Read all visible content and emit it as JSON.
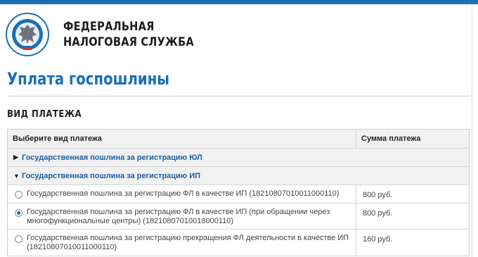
{
  "header": {
    "org_line1": "ФЕДЕРАЛЬНАЯ",
    "org_line2": "НАЛОГОВАЯ СЛУЖБА"
  },
  "page_title": "Уплата госпошлины",
  "section_title": "ВИД ПЛАТЕЖА",
  "table": {
    "col_type": "Выберите вид платежа",
    "col_sum": "Сумма платежа",
    "groups": [
      {
        "label": "Государственная пошлина за регистрацию ЮЛ",
        "expanded": false
      },
      {
        "label": "Государственная пошлина за регистрацию ИП",
        "expanded": true
      }
    ],
    "options": [
      {
        "label": "Государственная пошлина за регистрацию ФЛ в качестве ИП (18210807010011000110)",
        "sum": "800 руб.",
        "selected": false
      },
      {
        "label_line1": "Государственная пошлина за регистрацию ФЛ в качестве ИП (при обращении через",
        "label_line2": "многофункциональные центры) (18210807010018000110)",
        "sum": "800 руб.",
        "selected": true
      },
      {
        "label_line1": "Государственная пошлина за регистрацию прекращения ФЛ деятельности в качестве ИП",
        "label_line2": "(18210807010011000110)",
        "sum": "160 руб.",
        "selected": false
      }
    ]
  },
  "colors": {
    "accent": "#1a6fb5",
    "header_bg": "#f1f1f1"
  },
  "icons": {
    "logo": "fns-emblem-logo",
    "collapsed": "triangle-right-icon",
    "expanded": "triangle-down-icon"
  }
}
